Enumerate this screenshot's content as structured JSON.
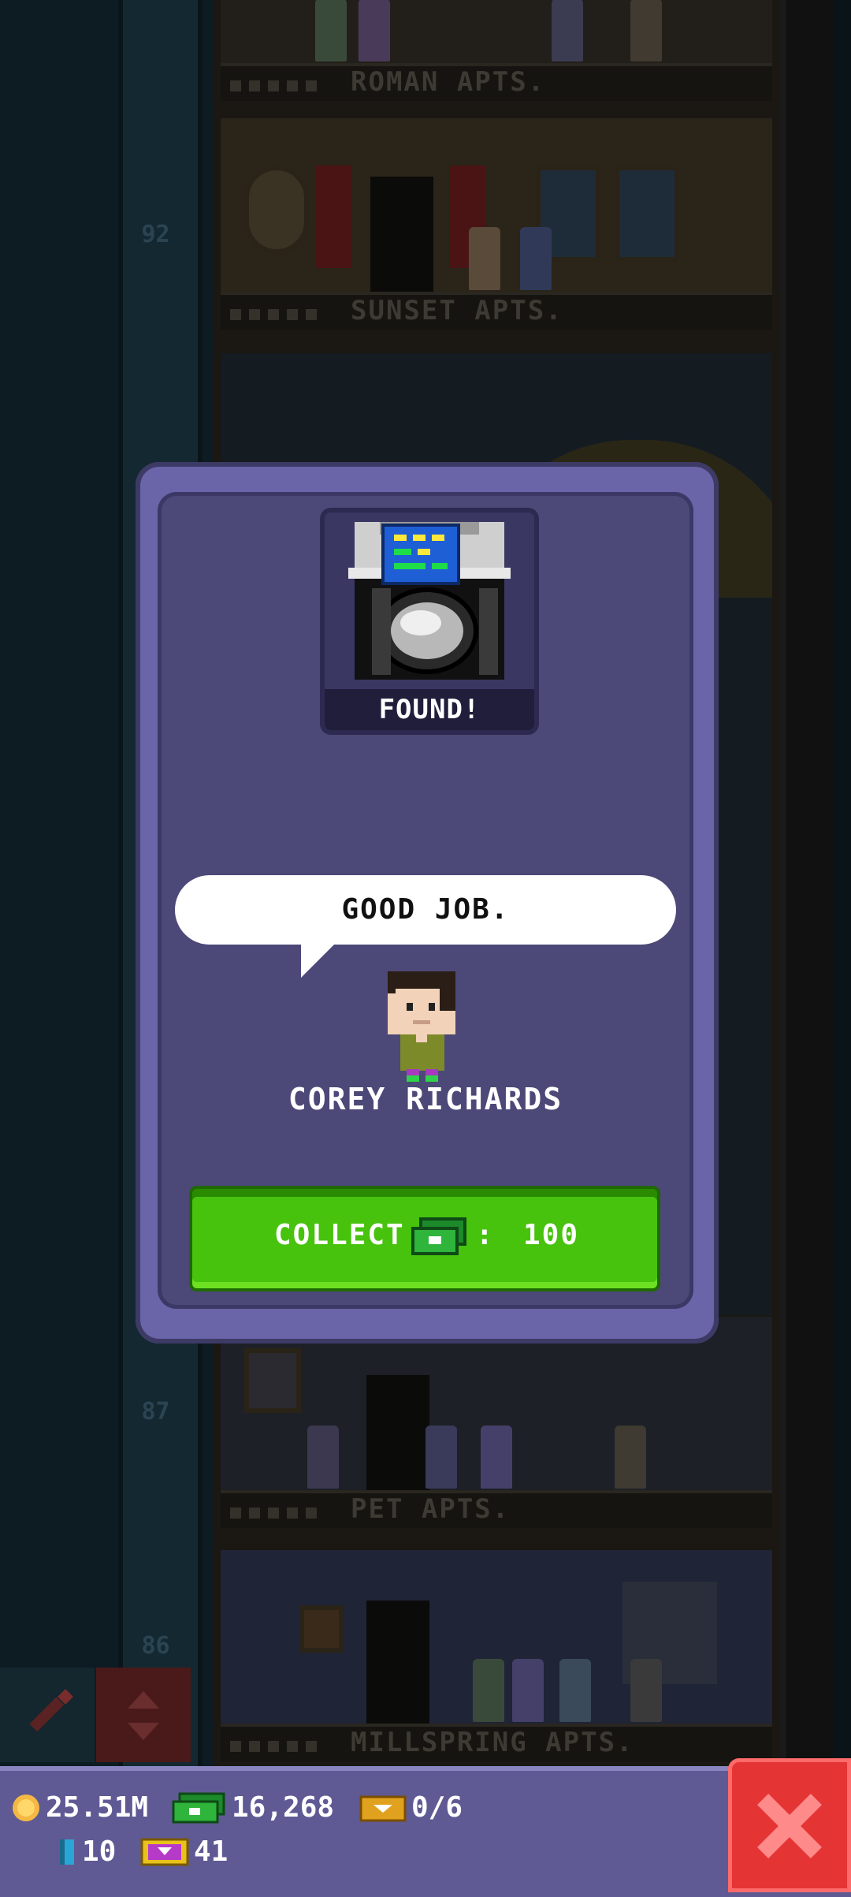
{
  "background": {
    "floor_numbers": [
      "92",
      "87",
      "86"
    ],
    "floors": [
      {
        "name": "ROMAN APTS."
      },
      {
        "name": "SUNSET APTS."
      },
      {
        "name": "PET APTS."
      },
      {
        "name": "MILLSPRING APTS."
      }
    ]
  },
  "modal": {
    "item": {
      "icon": "washing-machine-icon",
      "status": "FOUND!"
    },
    "speech": "GOOD JOB.",
    "character": {
      "name": "COREY RICHARDS",
      "icon": "bitizen-avatar-icon"
    },
    "collect": {
      "label": "COLLECT",
      "separator": ":",
      "amount": "100",
      "currency_icon": "bux-icon"
    }
  },
  "status_bar": {
    "coins": "25.51M",
    "bux": "16,268",
    "vip": "0/6",
    "keys": "10",
    "tickets": "41"
  },
  "colors": {
    "modal_outer": "#6a64a8",
    "modal_inner": "#4c4877",
    "collect_button": "#47c20d",
    "close_button": "#e53434",
    "status_bar": "#5f5a94"
  }
}
